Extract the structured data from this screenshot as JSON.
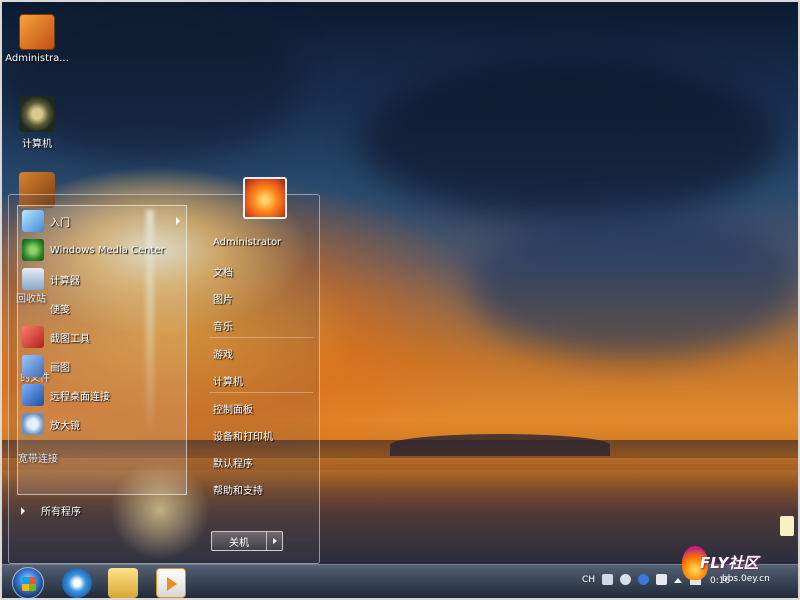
{
  "desktop": {
    "icons": [
      {
        "name": "admin-folder-icon",
        "label": "Administra..."
      },
      {
        "name": "computer-icon",
        "label": "计算机"
      },
      {
        "name": "recycle-bin-icon",
        "label": "回收站"
      }
    ],
    "behind_labels": {
      "docs": "的文件",
      "broadband": "宽带连接"
    }
  },
  "start_menu": {
    "left_items": [
      {
        "label": "入门",
        "has_submenu": true,
        "icon": "getting-started-icon"
      },
      {
        "label": "Windows Media Center",
        "icon": "media-center-icon"
      },
      {
        "label": "计算器",
        "icon": "calculator-icon"
      },
      {
        "label": "便笺",
        "icon": "sticky-notes-icon"
      },
      {
        "label": "截图工具",
        "icon": "snipping-tool-icon"
      },
      {
        "label": "画图",
        "icon": "paint-icon"
      },
      {
        "label": "远程桌面连接",
        "icon": "remote-desktop-icon"
      },
      {
        "label": "放大镜",
        "icon": "magnifier-icon"
      }
    ],
    "all_programs": "所有程序",
    "user_name": "Administrator",
    "right_items": [
      "文档",
      "图片",
      "音乐",
      "游戏",
      "计算机",
      "控制面板",
      "设备和打印机",
      "默认程序",
      "帮助和支持"
    ],
    "shutdown_label": "关机"
  },
  "taskbar": {
    "pinned": [
      "start-orb",
      "internet-explorer-icon",
      "windows-explorer-icon",
      "media-player-icon"
    ],
    "tray": {
      "language": "CH",
      "clock": "0:16"
    }
  },
  "watermark": {
    "brand": "FLY社区",
    "url": "bbs.0ey.cn"
  }
}
